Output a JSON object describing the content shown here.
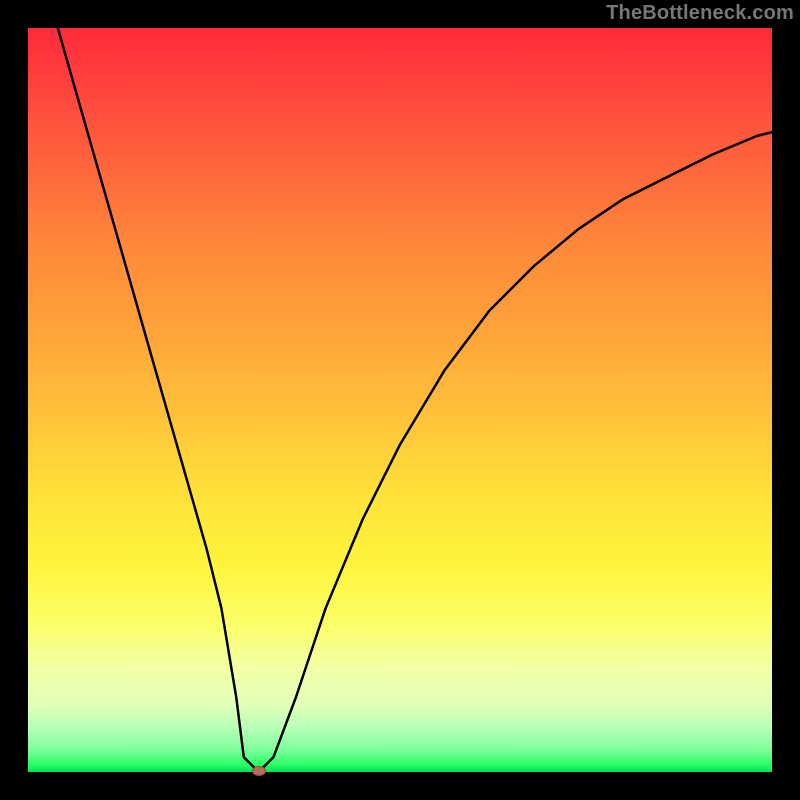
{
  "watermark": {
    "text": "TheBottleneck.com"
  },
  "chart_data": {
    "type": "line",
    "title": "",
    "xlabel": "",
    "ylabel": "",
    "xlim": [
      0,
      100
    ],
    "ylim": [
      0,
      100
    ],
    "grid": false,
    "legend": false,
    "series": [
      {
        "name": "bottleneck-curve",
        "x": [
          4,
          8,
          12,
          16,
          20,
          24,
          26,
          28,
          29,
          31,
          33,
          36,
          40,
          45,
          50,
          56,
          62,
          68,
          74,
          80,
          86,
          92,
          98,
          100
        ],
        "y": [
          100,
          86,
          72,
          58,
          44,
          30,
          22,
          10,
          2,
          0,
          2,
          10,
          22,
          34,
          44,
          54,
          62,
          68,
          73,
          77,
          80,
          83,
          85.5,
          86
        ]
      }
    ],
    "marker": {
      "name": "min-marker",
      "x": 31,
      "y": 0,
      "color": "#b86a5a"
    },
    "background_gradient": {
      "top": "#ff2a3a",
      "mid": "#fff43a",
      "bottom": "#00e050"
    }
  }
}
